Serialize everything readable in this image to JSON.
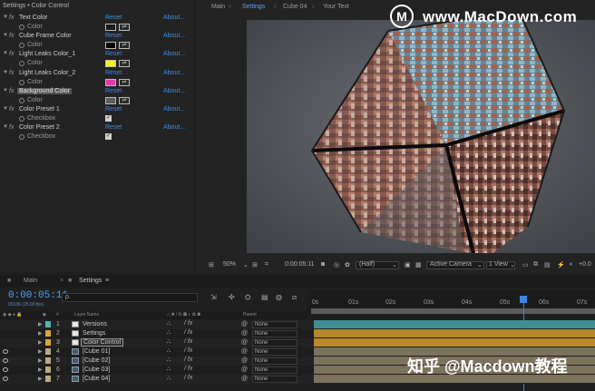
{
  "effect_controls": {
    "header": "Settings • Color Control",
    "fx_label": "fx",
    "reset_label": "Reset",
    "about_label": "About...",
    "effects": [
      {
        "name": "Text Color",
        "sub": "Color",
        "kind": "color",
        "color": "#1b1b1b"
      },
      {
        "name": "Cube Frame Color",
        "sub": "Color",
        "kind": "color",
        "color": "#050505"
      },
      {
        "name": "Light Leaks Color_1",
        "sub": "Color",
        "kind": "color",
        "color": "#f6f21c"
      },
      {
        "name": "Light Leaks Color_2",
        "sub": "Color",
        "kind": "color",
        "color": "#e23aa8"
      },
      {
        "name": "Background Color",
        "sub": "Color",
        "kind": "color",
        "color": "#5c5c5c",
        "highlight": true
      },
      {
        "name": "Color Preset 1",
        "sub": "Checkbox",
        "kind": "checkbox"
      },
      {
        "name": "Color Preset 2",
        "sub": "Checkbox",
        "kind": "checkbox"
      }
    ]
  },
  "composition": {
    "tabs": [
      "Main",
      "Settings",
      "Cube 04",
      "Your Text"
    ],
    "active_tab": 1,
    "viewer_bar": {
      "zoom": "50%",
      "timecode": "0:00:05:11",
      "resolution": "(Half)",
      "camera": "Active Camera",
      "views": "1 View",
      "offset": "+0.0"
    }
  },
  "watermark": {
    "logo_letter": "M",
    "site": "www.MacDown.com",
    "zh": "知乎 @Macdown教程"
  },
  "timeline": {
    "tabs": [
      "Main",
      "Settings"
    ],
    "timecode": "0:00:05:11",
    "fps": "00136 (25.00 fps)",
    "search_placeholder": "ρ.",
    "ruler_ticks": [
      "0s",
      "01s",
      "02s",
      "03s",
      "04s",
      "05s",
      "06s",
      "07s"
    ],
    "columns": {
      "hash": "#",
      "layer_name": "Layer Name",
      "parent": "Parent"
    },
    "layers": [
      {
        "num": "1",
        "name": "Versions",
        "label_color": "#4fb5b8",
        "type": "solid",
        "bar_color": "#3f8f92",
        "eye": false
      },
      {
        "num": "2",
        "name": "Settings",
        "label_color": "#d9a63a",
        "type": "solid",
        "bar_color": "#b5862a",
        "eye": false
      },
      {
        "num": "3",
        "name": "Color Control",
        "label_color": "#d9a63a",
        "type": "solid",
        "bar_color": "#b98a2c",
        "eye": false,
        "selected": true
      },
      {
        "num": "4",
        "name": "[Cube 01]",
        "label_color": "#b8a987",
        "type": "comp",
        "bar_color": "#7c735d",
        "eye": true
      },
      {
        "num": "5",
        "name": "[Cube 02]",
        "label_color": "#b8a987",
        "type": "comp",
        "bar_color": "#7c735d",
        "eye": true
      },
      {
        "num": "6",
        "name": "[Cube 03]",
        "label_color": "#b8a987",
        "type": "comp",
        "bar_color": "#7c735d",
        "eye": true
      },
      {
        "num": "7",
        "name": "[Cube 04]",
        "label_color": "#b8a987",
        "type": "comp",
        "bar_color": "#7c735d",
        "eye": true
      }
    ],
    "parent_value": "None"
  }
}
